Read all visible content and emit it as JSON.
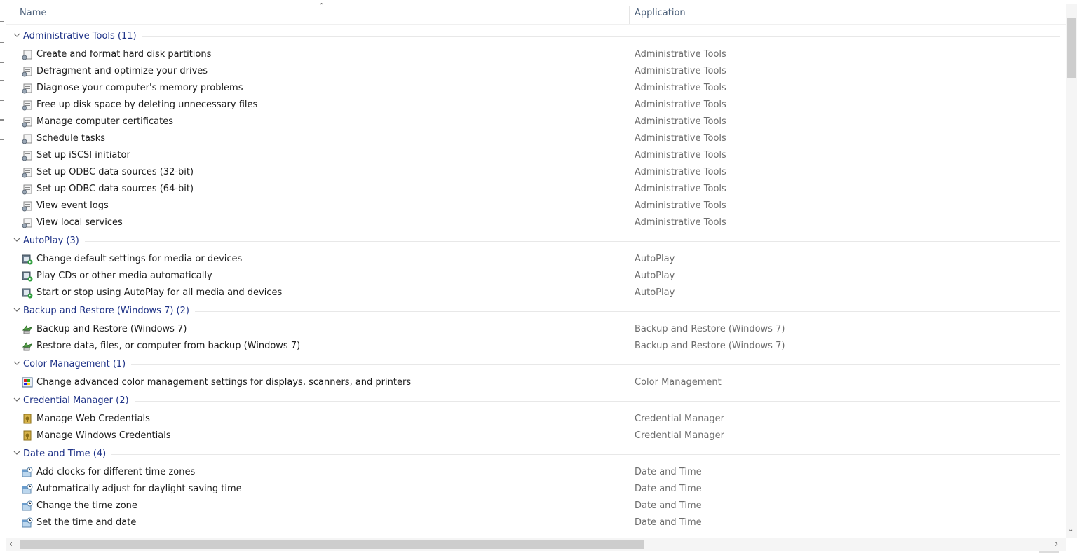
{
  "header": {
    "name_label": "Name",
    "application_label": "Application"
  },
  "groups": [
    {
      "title": "Administrative Tools (11)",
      "icon": "admin-tools-icon",
      "items": [
        {
          "name": "Create and format hard disk partitions",
          "app": "Administrative Tools"
        },
        {
          "name": "Defragment and optimize your drives",
          "app": "Administrative Tools"
        },
        {
          "name": "Diagnose your computer's memory problems",
          "app": "Administrative Tools"
        },
        {
          "name": "Free up disk space by deleting unnecessary files",
          "app": "Administrative Tools"
        },
        {
          "name": "Manage computer certificates",
          "app": "Administrative Tools"
        },
        {
          "name": "Schedule tasks",
          "app": "Administrative Tools"
        },
        {
          "name": "Set up iSCSI initiator",
          "app": "Administrative Tools"
        },
        {
          "name": "Set up ODBC data sources (32-bit)",
          "app": "Administrative Tools"
        },
        {
          "name": "Set up ODBC data sources (64-bit)",
          "app": "Administrative Tools"
        },
        {
          "name": "View event logs",
          "app": "Administrative Tools"
        },
        {
          "name": "View local services",
          "app": "Administrative Tools"
        }
      ]
    },
    {
      "title": "AutoPlay (3)",
      "icon": "autoplay-icon",
      "items": [
        {
          "name": "Change default settings for media or devices",
          "app": "AutoPlay"
        },
        {
          "name": "Play CDs or other media automatically",
          "app": "AutoPlay"
        },
        {
          "name": "Start or stop using AutoPlay for all media and devices",
          "app": "AutoPlay"
        }
      ]
    },
    {
      "title": "Backup and Restore (Windows 7) (2)",
      "icon": "backup-restore-icon",
      "items": [
        {
          "name": "Backup and Restore (Windows 7)",
          "app": "Backup and Restore (Windows 7)"
        },
        {
          "name": "Restore data, files, or computer from backup (Windows 7)",
          "app": "Backup and Restore (Windows 7)"
        }
      ]
    },
    {
      "title": "Color Management (1)",
      "icon": "color-management-icon",
      "items": [
        {
          "name": "Change advanced color management settings for displays, scanners, and printers",
          "app": "Color Management"
        }
      ]
    },
    {
      "title": "Credential Manager (2)",
      "icon": "credential-manager-icon",
      "items": [
        {
          "name": "Manage Web Credentials",
          "app": "Credential Manager"
        },
        {
          "name": "Manage Windows Credentials",
          "app": "Credential Manager"
        }
      ]
    },
    {
      "title": "Date and Time (4)",
      "icon": "date-time-icon",
      "items": [
        {
          "name": "Add clocks for different time zones",
          "app": "Date and Time"
        },
        {
          "name": "Automatically adjust for daylight saving time",
          "app": "Date and Time"
        },
        {
          "name": "Change the time zone",
          "app": "Date and Time"
        },
        {
          "name": "Set the time and date",
          "app": "Date and Time"
        }
      ]
    }
  ],
  "colors": {
    "group_title": "#1e3287",
    "app_text": "#6d6d6d",
    "header_text": "#4c607a"
  }
}
